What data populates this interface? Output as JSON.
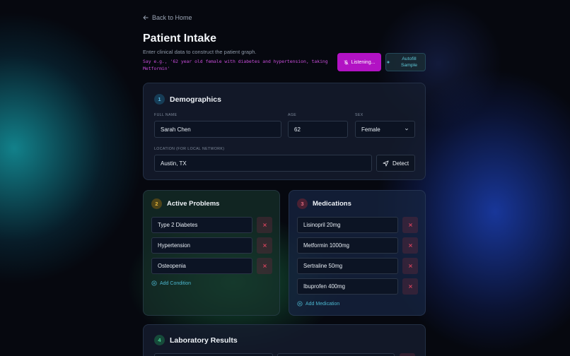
{
  "nav": {
    "back_label": "Back to Home"
  },
  "header": {
    "title": "Patient Intake",
    "subtitle": "Enter clinical data to construct the patient graph.",
    "voice_hint": "Say e.g., '62 year old female with diabetes and hypertension, taking Metformin'",
    "listening_label": "Listening...",
    "autofill_label": "Autofill Sample"
  },
  "demographics": {
    "number": "1",
    "title": "Demographics",
    "full_name_label": "FULL NAME",
    "full_name_value": "Sarah Chen",
    "age_label": "AGE",
    "age_value": "62",
    "sex_label": "SEX",
    "sex_value": "Female",
    "location_label": "LOCATION (FOR LOCAL NETWORK)",
    "location_value": "Austin, TX",
    "detect_label": "Detect"
  },
  "problems": {
    "number": "2",
    "title": "Active Problems",
    "items": [
      "Type 2 Diabetes",
      "Hypertension",
      "Osteopenia"
    ],
    "add_label": "Add Condition"
  },
  "medications": {
    "number": "3",
    "title": "Medications",
    "items": [
      "Lisinopril 20mg",
      "Metformin 1000mg",
      "Sertraline 50mg",
      "Ibuprofen 400mg"
    ],
    "add_label": "Add Medication"
  },
  "labs": {
    "number": "4",
    "title": "Laboratory Results"
  },
  "colors": {
    "listening_button": "#b212c4",
    "accent_cyan": "#5fc9d8",
    "remove_red": "#e0455f"
  },
  "icons": {
    "back": "arrow-left-icon",
    "listening": "mic-off-icon",
    "autofill": "sparkle-icon",
    "detect": "navigation-arrow-icon",
    "remove": "close-icon",
    "add": "plus-circle-icon",
    "select": "chevron-down-icon"
  }
}
